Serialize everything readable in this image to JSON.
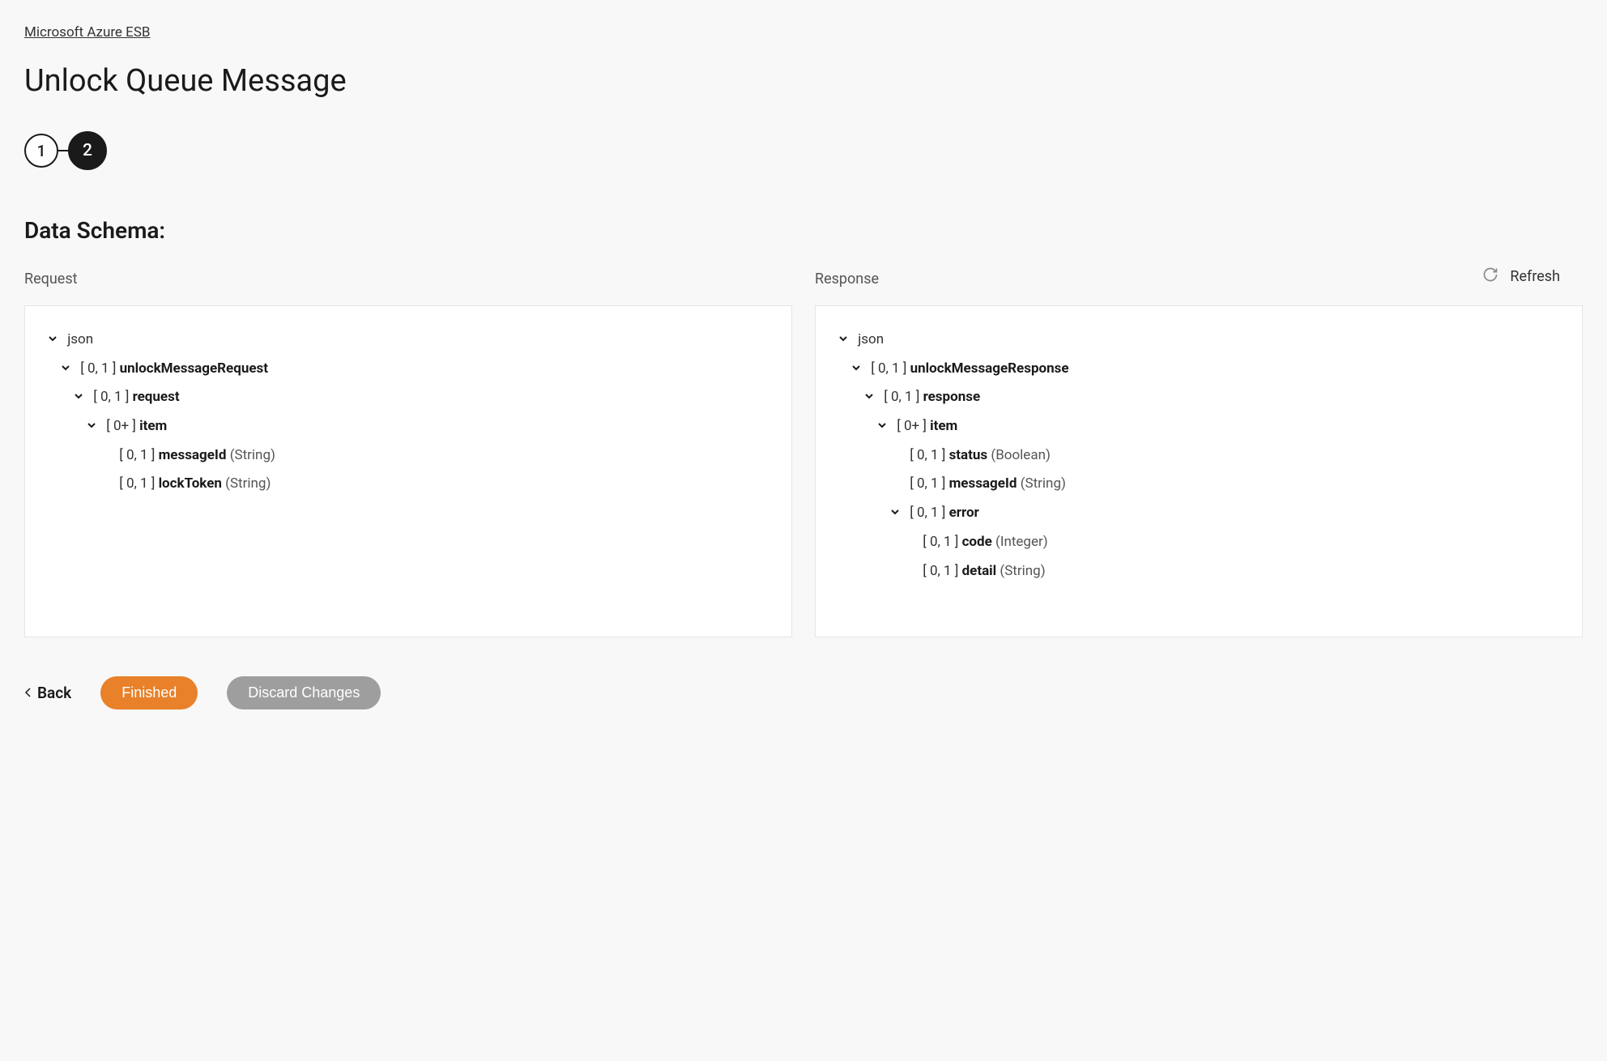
{
  "breadcrumb": "Microsoft Azure ESB",
  "title": "Unlock Queue Message",
  "stepper": {
    "step1": "1",
    "step2": "2"
  },
  "section_heading": "Data Schema:",
  "refresh_label": "Refresh",
  "request_label": "Request",
  "response_label": "Response",
  "request_tree": {
    "root": "json",
    "n0": {
      "card": "[ 0, 1 ]",
      "name": "unlockMessageRequest"
    },
    "n1": {
      "card": "[ 0, 1 ]",
      "name": "request"
    },
    "n2": {
      "card": "[ 0+ ]",
      "name": "item"
    },
    "n3": {
      "card": "[ 0, 1 ]",
      "name": "messageId",
      "type": "(String)"
    },
    "n4": {
      "card": "[ 0, 1 ]",
      "name": "lockToken",
      "type": "(String)"
    }
  },
  "response_tree": {
    "root": "json",
    "n0": {
      "card": "[ 0, 1 ]",
      "name": "unlockMessageResponse"
    },
    "n1": {
      "card": "[ 0, 1 ]",
      "name": "response"
    },
    "n2": {
      "card": "[ 0+ ]",
      "name": "item"
    },
    "n3": {
      "card": "[ 0, 1 ]",
      "name": "status",
      "type": "(Boolean)"
    },
    "n4": {
      "card": "[ 0, 1 ]",
      "name": "messageId",
      "type": "(String)"
    },
    "n5": {
      "card": "[ 0, 1 ]",
      "name": "error"
    },
    "n6": {
      "card": "[ 0, 1 ]",
      "name": "code",
      "type": "(Integer)"
    },
    "n7": {
      "card": "[ 0, 1 ]",
      "name": "detail",
      "type": "(String)"
    }
  },
  "footer": {
    "back": "Back",
    "finished": "Finished",
    "discard": "Discard Changes"
  }
}
